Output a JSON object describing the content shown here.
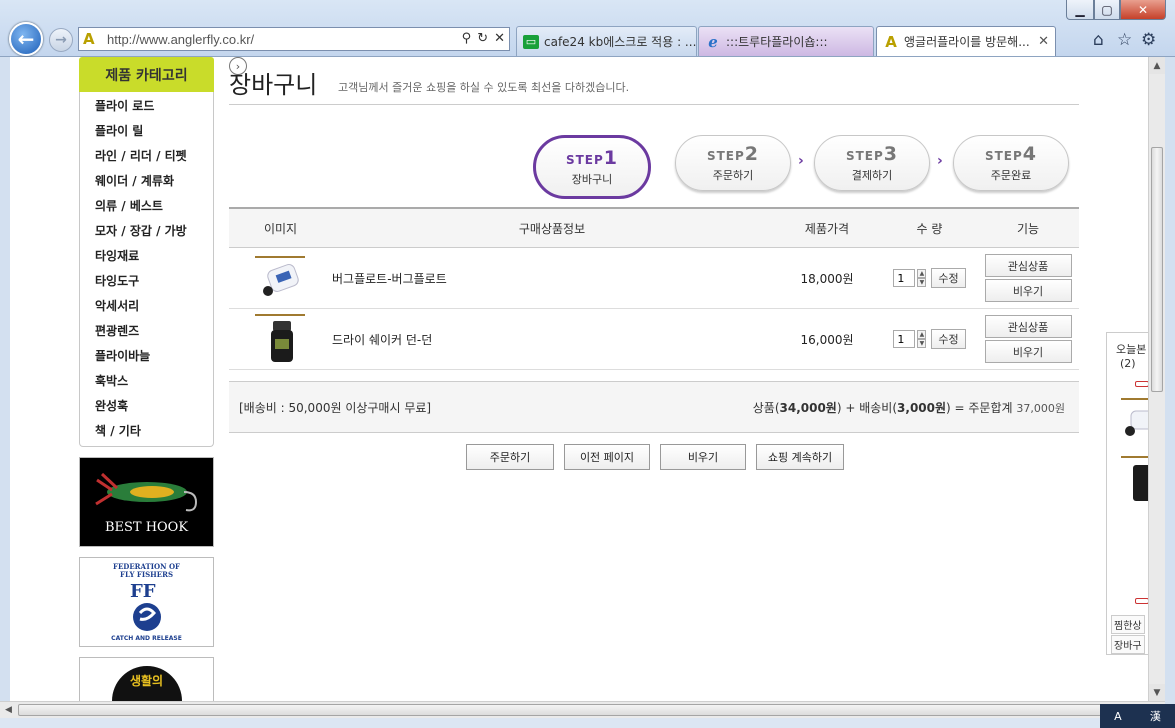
{
  "browser": {
    "url": "http://www.anglerfly.co.kr/",
    "tabs": [
      {
        "label": "cafe24 kb에스크로 적용 : ..."
      },
      {
        "label": ":::트루타플라이숍:::"
      },
      {
        "label": "앵글러플라이를 방문해..."
      }
    ],
    "window_controls": {
      "min": "▁",
      "max": "▢",
      "close": "✕"
    }
  },
  "sidebar": {
    "header": "제품 카테고리",
    "items": [
      {
        "label": "플라이 로드"
      },
      {
        "label": "플라이 릴"
      },
      {
        "label": "라인 / 리더 / 티펫"
      },
      {
        "label": "웨이더 / 계류화"
      },
      {
        "label": "의류 / 베스트"
      },
      {
        "label": "모자 / 장갑 / 가방"
      },
      {
        "label": "타잉재료"
      },
      {
        "label": "타잉도구"
      },
      {
        "label": "악세서리"
      },
      {
        "label": "편광렌즈"
      },
      {
        "label": "플라이바늘"
      },
      {
        "label": "훅박스"
      },
      {
        "label": "완성훅"
      },
      {
        "label": "책 / 기타"
      }
    ],
    "banners": {
      "hook": "BEST HOOK",
      "fff_top": "FEDERATION OF FLY FISHERS",
      "fff_bottom": "CATCH AND RELEASE",
      "life": "생활의"
    }
  },
  "page": {
    "title": "장바구니",
    "subtitle": "고객님께서 즐거운 쇼핑을 하실 수 있도록 최선을 다하겠습니다."
  },
  "steps": [
    {
      "word": "STEP",
      "num": "1",
      "label": "장바구니"
    },
    {
      "word": "STEP",
      "num": "2",
      "label": "주문하기"
    },
    {
      "word": "STEP",
      "num": "3",
      "label": "결제하기"
    },
    {
      "word": "STEP",
      "num": "4",
      "label": "주문완료"
    }
  ],
  "cart": {
    "headers": {
      "image": "이미지",
      "info": "구매상품정보",
      "price": "제품가격",
      "qty": "수 량",
      "fn": "기능"
    },
    "rows": [
      {
        "name": "버그플로트-버그플로트",
        "price": "18,000원",
        "qty": "1",
        "update": "수정",
        "wish": "관심상품",
        "remove": "비우기"
      },
      {
        "name": "드라이 쉐이커 던-던",
        "price": "16,000원",
        "qty": "1",
        "update": "수정",
        "wish": "관심상품",
        "remove": "비우기"
      }
    ]
  },
  "summary": {
    "shipping_note": "[배송비 : 50,000원 이상구매시 무료]",
    "goods_label": "상품(",
    "goods_value": "34,000원",
    "plus": ") + 배송비(",
    "ship_value": "3,000원",
    "eq": ") = 주문합계",
    "total": "37,000원"
  },
  "actions": {
    "order": "주문하기",
    "prev": "이전 페이지",
    "empty": "비우기",
    "continue": "쇼핑 계속하기"
  },
  "today": {
    "title": "오늘본",
    "count": "(2)",
    "link1": "찜한상",
    "link2": "장바구"
  },
  "tray": {
    "ime": "A",
    "lang": "漢"
  }
}
